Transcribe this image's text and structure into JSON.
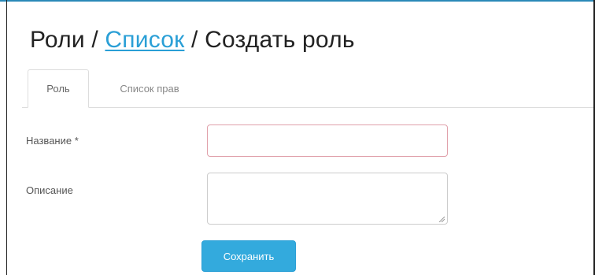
{
  "breadcrumb": {
    "root": "Роли",
    "separator": "/",
    "list_link": "Список",
    "current": "Создать роль"
  },
  "tabs": [
    {
      "label": "Роль",
      "active": true
    },
    {
      "label": "Список прав",
      "active": false
    }
  ],
  "form": {
    "name_label": "Название *",
    "name_value": "",
    "description_label": "Описание",
    "description_value": "",
    "save_label": "Сохранить"
  },
  "colors": {
    "link": "#2a9fd6",
    "primary_button": "#33aadd",
    "required_border": "#e0a0aa"
  }
}
